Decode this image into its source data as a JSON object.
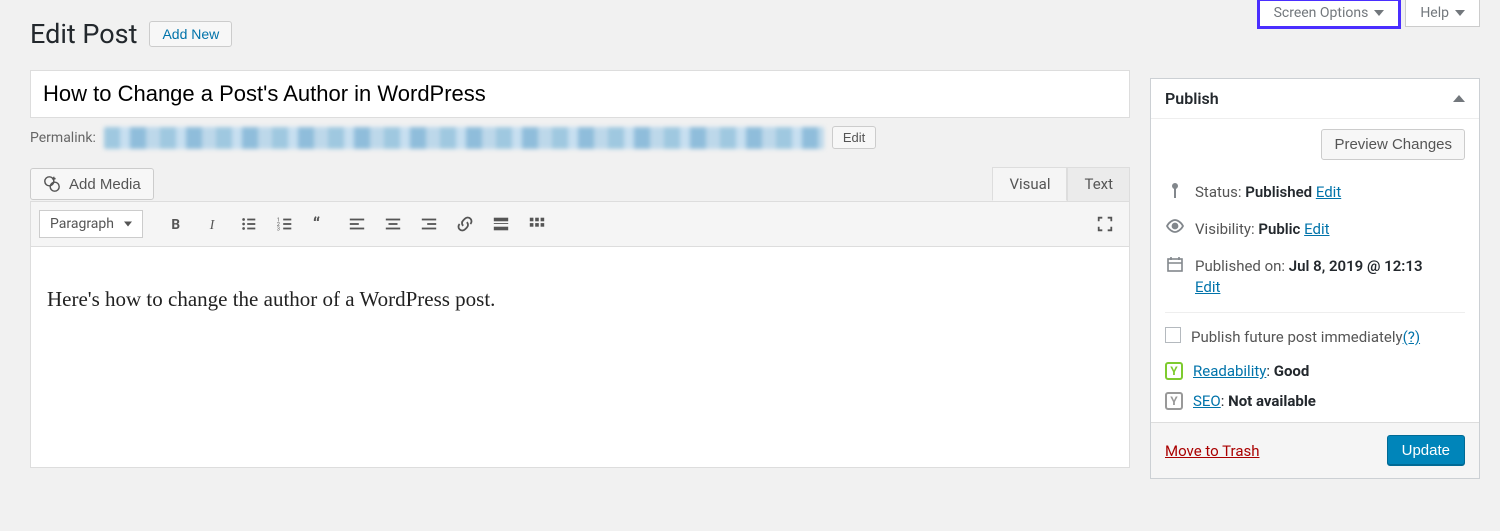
{
  "top_tabs": {
    "screen_options": "Screen Options",
    "help": "Help"
  },
  "header": {
    "page_title": "Edit Post",
    "add_new": "Add New"
  },
  "post": {
    "title": "How to Change a Post's Author in WordPress",
    "permalink_label": "Permalink:",
    "permalink_edit": "Edit",
    "body": "Here's how to change the author of a WordPress post."
  },
  "media": {
    "add_media": "Add Media"
  },
  "editor": {
    "tabs": {
      "visual": "Visual",
      "text": "Text"
    },
    "format": "Paragraph"
  },
  "publish": {
    "title": "Publish",
    "preview": "Preview Changes",
    "status_label": "Status:",
    "status_value": "Published",
    "status_edit": "Edit",
    "visibility_label": "Visibility:",
    "visibility_value": "Public",
    "visibility_edit": "Edit",
    "published_label": "Published on:",
    "published_value": "Jul 8, 2019 @ 12:13",
    "published_edit": "Edit",
    "future_label": "Publish future post immediately",
    "future_help": "(?)",
    "readability_label": "Readability",
    "readability_value": "Good",
    "seo_label": "SEO",
    "seo_value": "Not available",
    "trash": "Move to Trash",
    "update": "Update"
  }
}
